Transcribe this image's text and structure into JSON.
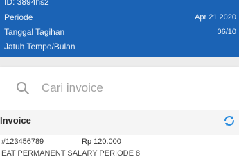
{
  "header": {
    "lines": [
      "ID: 3894hs2",
      "Periode",
      "Tanggal Tagihan",
      "Jatuh Tempo/Bulan"
    ],
    "values": {
      "periode": "Apr 21 2020",
      "tanggal": "06/10"
    }
  },
  "search": {
    "placeholder": "Cari invoice"
  },
  "list": {
    "section_title": "Invoice",
    "items": [
      {
        "number": "#123456789",
        "amount": "Rp 120.000",
        "description": "EAT PERMANENT SALARY PERIODE 8"
      }
    ]
  },
  "colors": {
    "header_bg": "#1b63b5",
    "accent": "#2a8cde"
  },
  "icons": {
    "search": "search-icon",
    "sync": "sync-icon"
  }
}
